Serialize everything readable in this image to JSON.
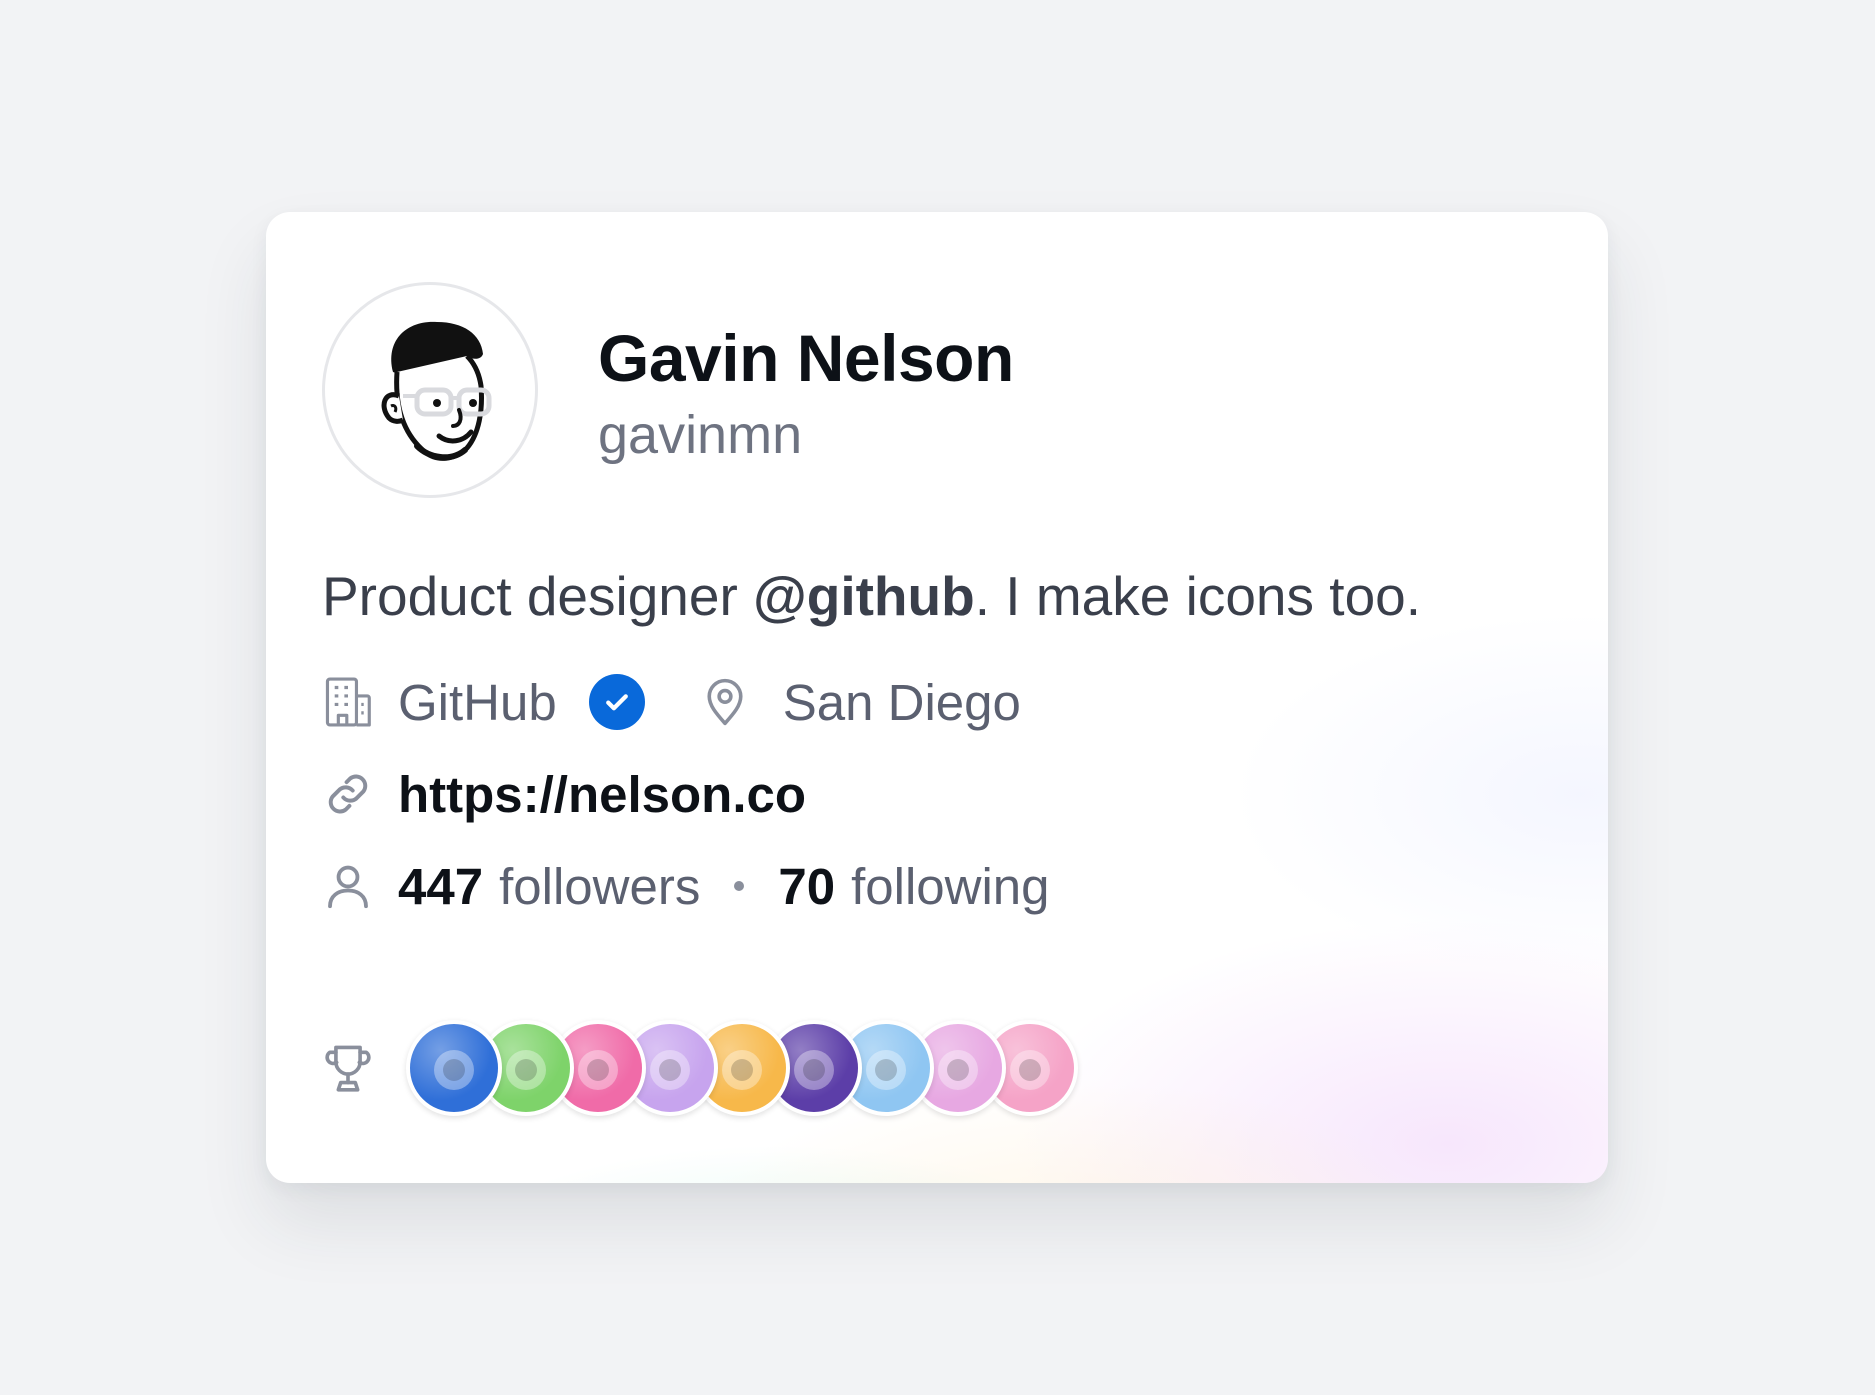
{
  "profile": {
    "name": "Gavin Nelson",
    "login": "gavinmn",
    "bio_prefix": "Product designer ",
    "bio_mention": "@github",
    "bio_suffix": ". I make icons too.",
    "company": "GitHub",
    "company_verified": true,
    "location": "San Diego",
    "website": "https://nelson.co",
    "followers_count": "447",
    "followers_label": "followers",
    "following_count": "70",
    "following_label": "following"
  },
  "icons": {
    "company": "building-icon",
    "verified": "verified-check-icon",
    "location": "location-pin-icon",
    "website": "link-icon",
    "people": "person-icon",
    "achievements": "trophy-icon"
  },
  "achievements": [
    {
      "name": "shark-badge",
      "color": "#2f6fd8"
    },
    {
      "name": "pea-pod-badge",
      "color": "#7ed36a"
    },
    {
      "name": "heart-badge",
      "color": "#f06ba8"
    },
    {
      "name": "wizard-hat-badge",
      "color": "#c7a4ee"
    },
    {
      "name": "cowboy-badge",
      "color": "#f7b84a"
    },
    {
      "name": "brain-badge",
      "color": "#5c3ea8"
    },
    {
      "name": "code-block-badge",
      "color": "#8fc6f2"
    },
    {
      "name": "star-struck-cat-badge",
      "color": "#e7a8e2"
    },
    {
      "name": "yolo-badge",
      "color": "#f5a3c7"
    }
  ],
  "colors": {
    "verified": "#0969da",
    "name_text": "#0d1117",
    "secondary_text": "#6e7381"
  }
}
